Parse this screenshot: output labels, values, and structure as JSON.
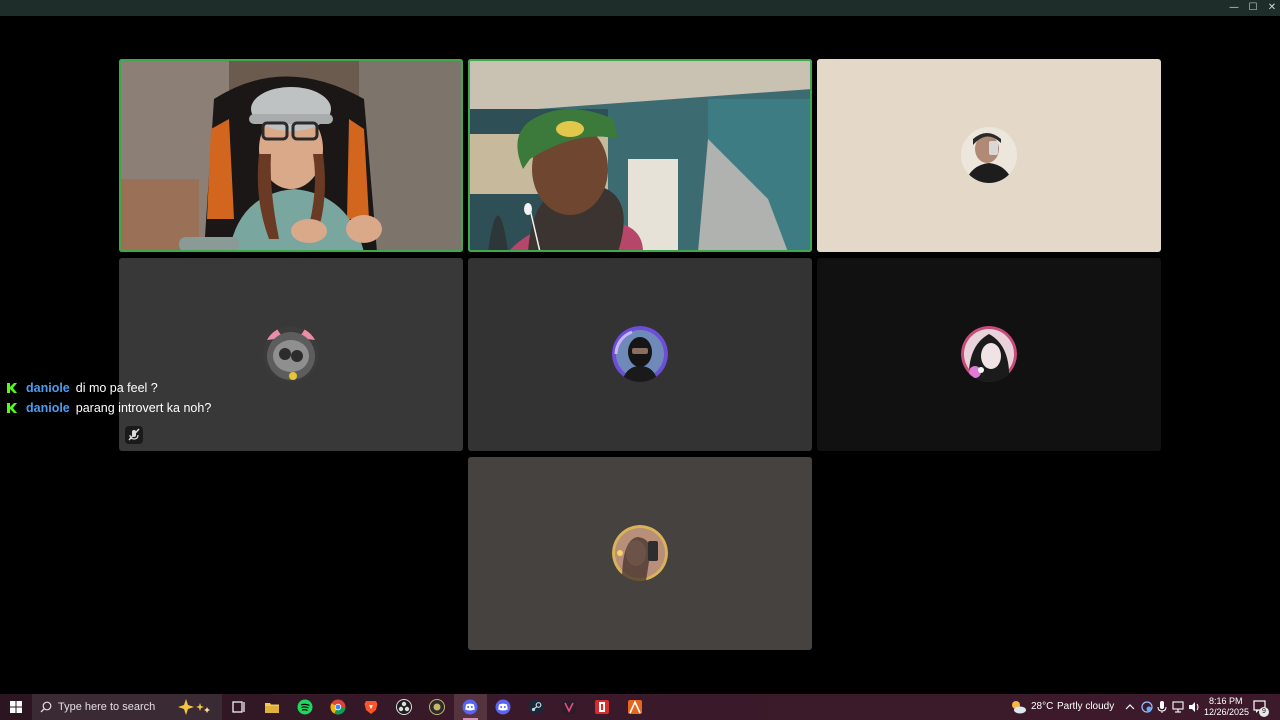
{
  "window": {
    "controls": {
      "minimize": "—",
      "maximize": "☐",
      "close": "✕"
    }
  },
  "participants": [
    {
      "id": "p1",
      "kind": "video",
      "speaking": true,
      "desc": "woman in grey cap and glasses"
    },
    {
      "id": "p2",
      "kind": "video",
      "speaking": true,
      "desc": "man in green cap"
    },
    {
      "id": "p3",
      "kind": "avatar",
      "bg": "#e4d9c8"
    },
    {
      "id": "p4",
      "kind": "avatar",
      "bg": "#383838",
      "muted": true
    },
    {
      "id": "p5",
      "kind": "avatar",
      "bg": "#333333"
    },
    {
      "id": "p6",
      "kind": "avatar",
      "bg": "#111111"
    },
    {
      "id": "p7",
      "kind": "avatar",
      "bg": "#45423f"
    }
  ],
  "chat": [
    {
      "user": "daniole",
      "text": "di mo pa feel ?"
    },
    {
      "user": "daniole",
      "text": "parang introvert ka noh?"
    }
  ],
  "taskbar": {
    "search_placeholder": "Type here to search",
    "apps": [
      "task-view",
      "file-explorer",
      "spotify",
      "chrome",
      "brave",
      "obs",
      "app",
      "discord-activity",
      "discord",
      "steam",
      "vscode-like",
      "brawlhalla",
      "affinity"
    ],
    "weather": {
      "temp": "28°C",
      "condition": "Partly cloudy"
    },
    "clock": {
      "time": "8:16 PM",
      "date": "12/26/2025"
    },
    "notifications": "9"
  },
  "colors": {
    "speaking_outline": "#3fa84a",
    "chat_user": "#4d9cf1",
    "accent": "#d28fb3"
  }
}
